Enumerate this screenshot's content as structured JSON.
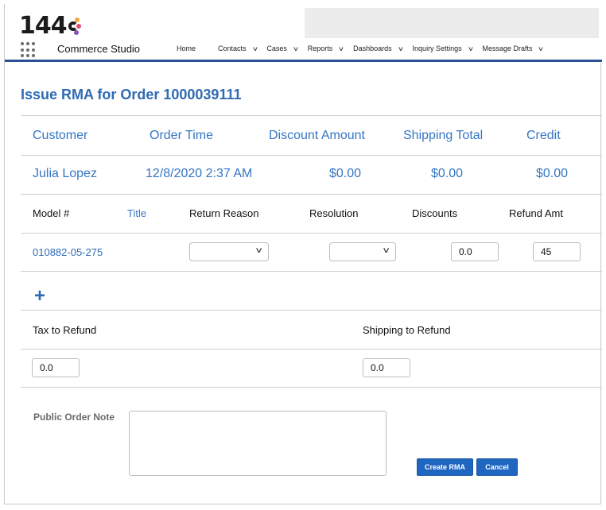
{
  "logo": {
    "text": "144",
    "dot_colors": [
      "#f2a93b",
      "#e24b6a",
      "#8a4fc4"
    ]
  },
  "app": {
    "name": "Commerce Studio"
  },
  "nav": {
    "home": "Home",
    "items": [
      "Contacts",
      "Cases",
      "Reports",
      "Dashboards",
      "Inquiry Settings",
      "Message Drafts"
    ]
  },
  "page": {
    "title": "Issue RMA for Order 1000039111"
  },
  "summary": {
    "headers": [
      "Customer",
      "Order Time",
      "Discount Amount",
      "Shipping Total",
      "Credit"
    ],
    "values": [
      "Julia Lopez",
      "12/8/2020 2:37 AM",
      "$0.00",
      "$0.00",
      "$0.00"
    ]
  },
  "line_items": {
    "headers": [
      "Model #",
      "Title",
      "Return Reason",
      "Resolution",
      "Discounts",
      "Refund Amt"
    ],
    "row": {
      "model": "010882-05-275",
      "title": "",
      "return_reason": "",
      "resolution": "",
      "discounts": "0.0",
      "refund_amt": "45"
    }
  },
  "add_row": {
    "icon": "plus-icon"
  },
  "refunds": {
    "tax_label": "Tax to Refund",
    "tax_value": "0.0",
    "shipping_label": "Shipping to Refund",
    "shipping_value": "0.0"
  },
  "note": {
    "label": "Public Order Note",
    "value": ""
  },
  "actions": {
    "create": "Create RMA",
    "cancel": "Cancel"
  },
  "colors": {
    "accent": "#2f6bb3",
    "nav_bar": "#2a4f96",
    "button": "#1f66c1"
  }
}
